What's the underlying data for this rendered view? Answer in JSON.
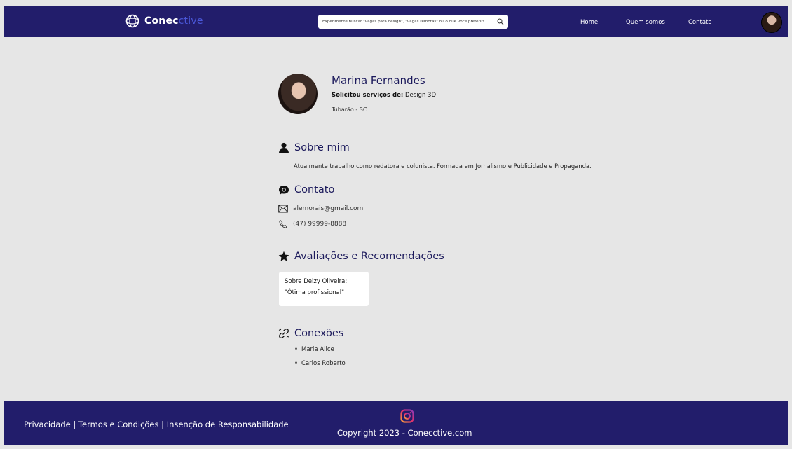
{
  "header": {
    "logo": {
      "text_main": "Conec",
      "text_accent": "ctive",
      "icon": "globe-icon"
    },
    "search": {
      "placeholder": "Experimente buscar \"vagas para design\", \"vagas remotas\" ou o que você preferir!"
    },
    "nav": [
      {
        "label": "Home"
      },
      {
        "label": "Quem somos"
      },
      {
        "label": "Contato"
      }
    ]
  },
  "profile": {
    "name": "Marina Fernandes",
    "service_label": "Solicitou serviços de:",
    "service_value": "Design 3D",
    "location": "Tubarão - SC"
  },
  "about": {
    "title": "Sobre mim",
    "icon": "user-icon",
    "text": "Atualmente trabalho como redatora e colunista. Formada em Jornalismo e Publicidade e Propaganda."
  },
  "contact": {
    "title": "Contato",
    "icon": "chat-icon",
    "email": "alemorais@gmail.com",
    "phone": "(47) 99999-8888"
  },
  "reviews": {
    "title": "Avaliações e Recomendações",
    "icon": "star-icon",
    "items": [
      {
        "prefix": "Sobre",
        "author": "Deizy Oliveira",
        "suffix": ":",
        "text": "\"Ótima profissional\""
      }
    ]
  },
  "connections": {
    "title": "Conexões",
    "icon": "link-icon",
    "items": [
      {
        "name": "Maria Alice"
      },
      {
        "name": "Carlos Roberto"
      }
    ]
  },
  "footer": {
    "links": [
      "Privacidade",
      "Termos e Condições",
      "Insenção de Responsabilidade"
    ],
    "separator": " | ",
    "copyright": "Copyright 2023 - Conecctive.com",
    "icon": "instagram-icon"
  },
  "colors": {
    "header_bg": "#221d6b",
    "page_bg": "#e6e6e6",
    "heading": "#1c1a5c",
    "accent": "#4a57d8"
  }
}
